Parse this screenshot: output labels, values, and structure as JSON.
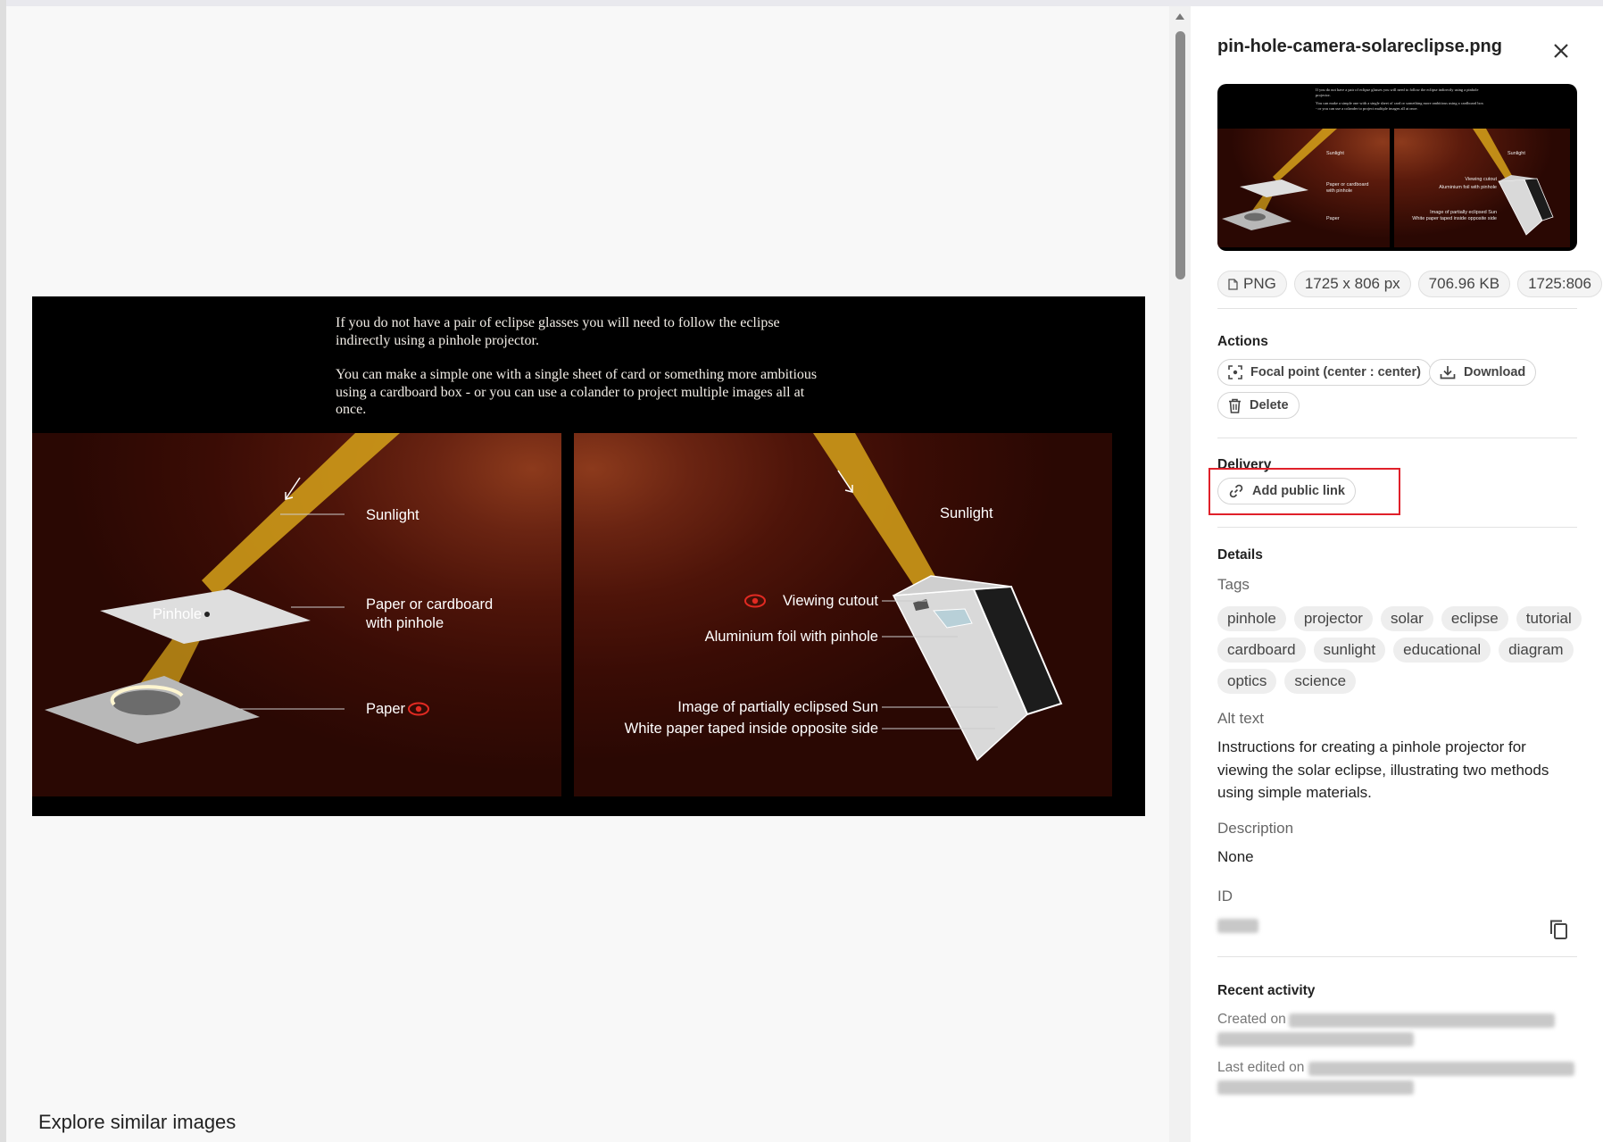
{
  "file": {
    "name": "pin-hole-camera-solareclipse.png",
    "format": "PNG",
    "dimensions": "1725 x 806 px",
    "size": "706.96 KB",
    "ratio": "1725:806"
  },
  "image": {
    "intro_1": "If you do not have a pair of eclipse glasses you will need to follow the eclipse indirectly using a pinhole projector.",
    "intro_2": "You can make a simple one with a single sheet of card or something more ambitious using a cardboard box - or you can use a colander to project multiple images all at once.",
    "left_labels": {
      "sunlight": "Sunlight",
      "pinhole": "Pinhole",
      "card_1": "Paper or cardboard",
      "card_2": "with pinhole",
      "paper": "Paper"
    },
    "right_labels": {
      "sunlight": "Sunlight",
      "cutout": "Viewing cutout",
      "foil": "Aluminium foil with pinhole",
      "image_sun": "Image of partially eclipsed Sun",
      "white_paper": "White paper taped inside opposite side"
    }
  },
  "main": {
    "explore": "Explore similar images"
  },
  "actions": {
    "heading": "Actions",
    "focal_point": "Focal point (center : center)",
    "download": "Download",
    "delete": "Delete"
  },
  "delivery": {
    "heading": "Delivery",
    "add_public_link": "Add public link"
  },
  "details": {
    "heading": "Details",
    "tags_label": "Tags",
    "tags": [
      "pinhole",
      "projector",
      "solar",
      "eclipse",
      "tutorial",
      "cardboard",
      "sunlight",
      "educational",
      "diagram",
      "optics",
      "science"
    ],
    "alt_label": "Alt text",
    "alt_text": "Instructions for creating a pinhole projector for viewing the solar eclipse, illustrating two methods using simple materials.",
    "description_label": "Description",
    "description": "None",
    "id_label": "ID"
  },
  "activity": {
    "heading": "Recent activity",
    "created_label": "Created on",
    "edited_label": "Last edited on"
  },
  "colors": {
    "accent_red": "#e0202a",
    "beam": "#d6a21a",
    "panel_dark": "#2a0803"
  }
}
